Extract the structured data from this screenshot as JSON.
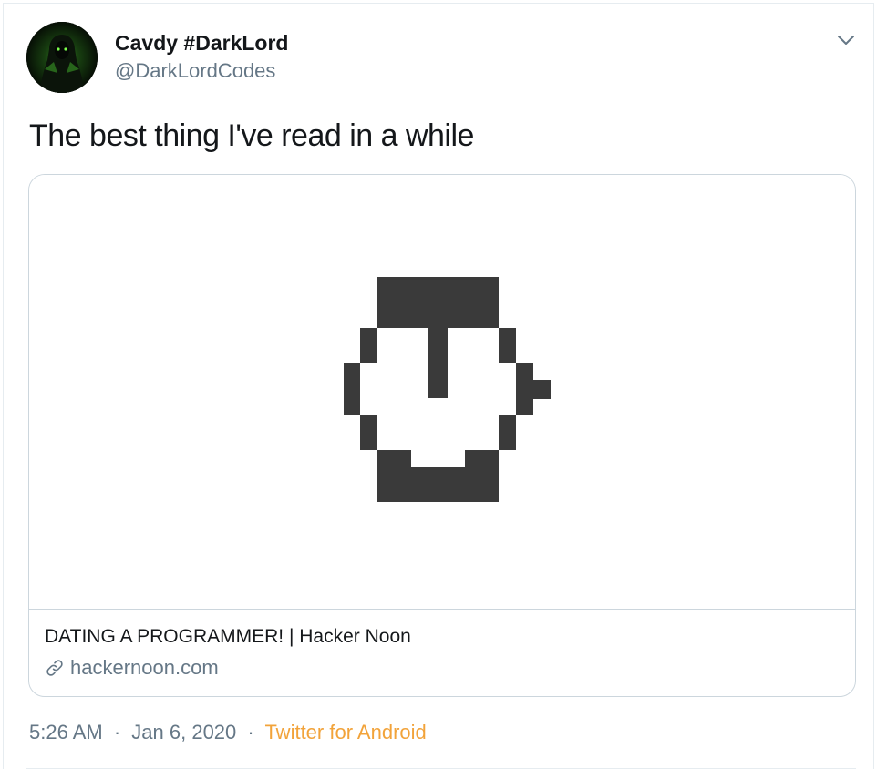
{
  "author": {
    "display_name": "Cavdy #DarkLord",
    "handle": "@DarkLordCodes",
    "avatar_icon": "dark-hooded-figure-avatar"
  },
  "menu": {
    "icon": "chevron-down-icon"
  },
  "tweet": {
    "text": "The best thing I've read in a while"
  },
  "card": {
    "image_icon": "pixel-stopwatch-logo",
    "title": "DATING A PROGRAMMER! | Hacker Noon",
    "domain": "hackernoon.com",
    "domain_icon": "link-icon"
  },
  "meta": {
    "time": "5:26 AM",
    "separator": "·",
    "date": "Jan 6, 2020",
    "source": "Twitter for Android"
  },
  "colors": {
    "text": "#14171a",
    "secondary": "#657786",
    "border": "#ccd6dd",
    "source_link": "#f2a33a",
    "logo": "#3a3a3a"
  }
}
